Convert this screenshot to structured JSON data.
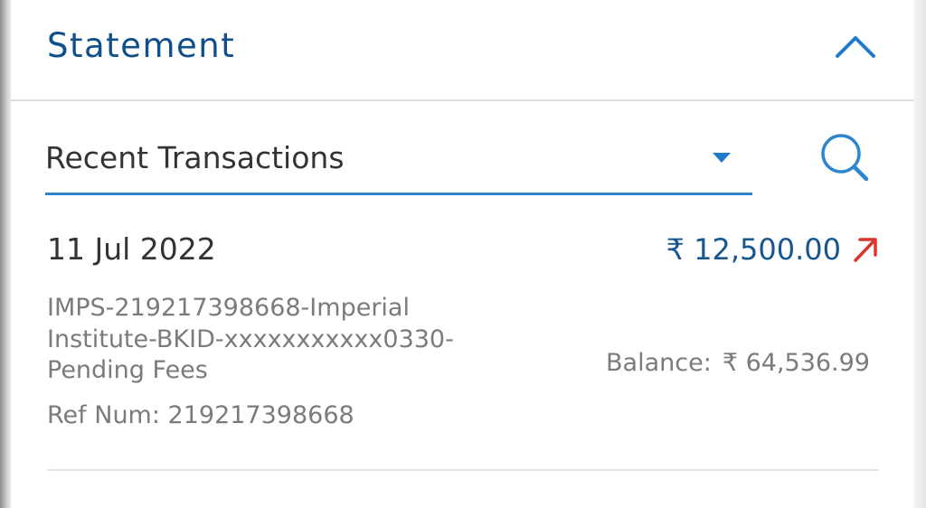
{
  "header": {
    "title": "Statement",
    "toggle_icon": "chevron-up-icon"
  },
  "filter": {
    "selected": "Recent Transactions",
    "dropdown_icon": "caret-down-icon",
    "search_icon": "search-icon"
  },
  "transactions": [
    {
      "date": "11 Jul 2022",
      "amount": "₹ 12,500.00",
      "direction_icon": "arrow-up-right-icon",
      "description": "IMPS-219217398668-Imperial Institute-BKID-xxxxxxxxxxx0330-Pending Fees",
      "ref": "Ref Num: 219217398668",
      "balance_label": "Balance:",
      "balance_value": "₹ 64,536.99"
    }
  ],
  "colors": {
    "title": "#114f8a",
    "accent": "#2d85cf",
    "amount": "#17578f",
    "debit": "#d9352b",
    "muted_text": "#7b7b7b"
  }
}
